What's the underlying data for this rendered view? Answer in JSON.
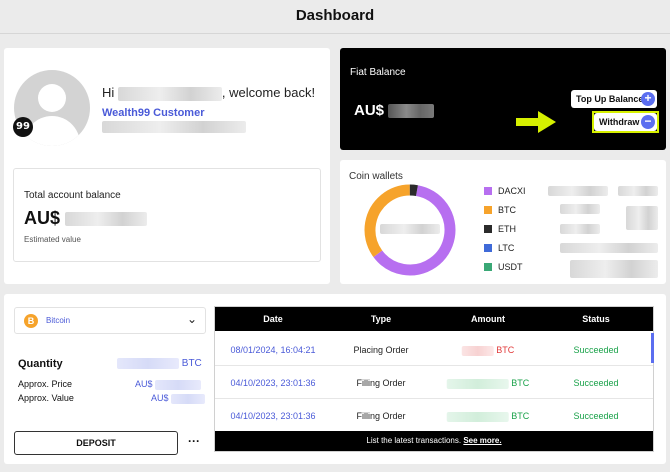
{
  "header": {
    "title": "Dashboard"
  },
  "profile": {
    "greeting_prefix": "Hi",
    "greeting_suffix": ", welcome back!",
    "customer_label": "Wealth99 Customer",
    "badge": "99"
  },
  "account_balance": {
    "label": "Total account balance",
    "currency": "AU$",
    "note": "Estimated value"
  },
  "fiat": {
    "title": "Fiat Balance",
    "currency": "AU$",
    "top_up_label": "Top Up Balance",
    "top_up_icon": "+",
    "withdraw_label": "Withdraw",
    "withdraw_icon": "−",
    "highlight_color": "#d6f000"
  },
  "coin_wallets": {
    "title": "Coin wallets",
    "legend": [
      {
        "name": "DACXI",
        "color": "#b76ff0"
      },
      {
        "name": "BTC",
        "color": "#f6a32b"
      },
      {
        "name": "ETH",
        "color": "#2b2b2b"
      },
      {
        "name": "LTC",
        "color": "#3f6ad8"
      },
      {
        "name": "USDT",
        "color": "#3aa876"
      }
    ]
  },
  "chart_data": {
    "type": "pie",
    "categories": [
      "DACXI",
      "BTC",
      "ETH"
    ],
    "values": [
      62,
      35,
      3
    ],
    "colors": [
      "#b76ff0",
      "#f6a32b",
      "#2b2b2b"
    ],
    "title": "Coin wallets"
  },
  "asset_select": {
    "selected": "Bitcoin",
    "icon": "B"
  },
  "holdings": {
    "quantity_label": "Quantity",
    "quantity_unit": "BTC",
    "price_label": "Approx. Price",
    "value_label": "Approx. Value",
    "currency": "AU$"
  },
  "actions": {
    "deposit_label": "DEPOSIT",
    "more_label": "···"
  },
  "transactions": {
    "headers": [
      "Date",
      "Type",
      "Amount",
      "Status"
    ],
    "rows": [
      {
        "date": "08/01/2024, 16:04:21",
        "type": "Placing Order",
        "unit": "BTC",
        "status": "Succeeded",
        "amount_color": "red"
      },
      {
        "date": "04/10/2023, 23:01:36",
        "type": "Filling Order",
        "unit": "BTC",
        "status": "Succeeded",
        "amount_color": "green"
      },
      {
        "date": "04/10/2023, 23:01:36",
        "type": "Filling Order",
        "unit": "BTC",
        "status": "Succeeded",
        "amount_color": "green"
      }
    ],
    "footer_text": "List the latest transactions.",
    "footer_link": "See more."
  }
}
